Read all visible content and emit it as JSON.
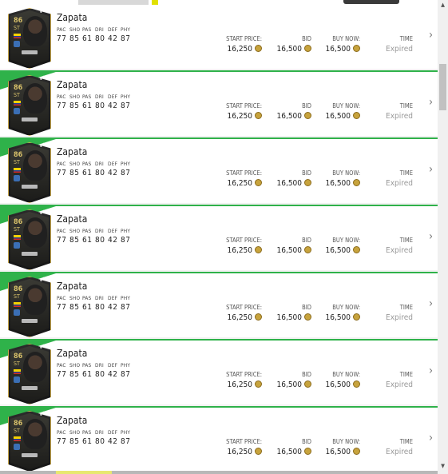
{
  "stat_labels": [
    "PAC",
    "SHO",
    "PAS",
    "DRI",
    "DEF",
    "PHY"
  ],
  "column_labels": {
    "start": "START PRICE:",
    "bid": "BID",
    "buy_now": "BUY NOW:",
    "time": "TIME"
  },
  "items": [
    {
      "name": "Zapata",
      "rating": "86",
      "position": "ST",
      "stats": [
        "77",
        "85",
        "61",
        "80",
        "42",
        "87"
      ],
      "start_price": "16,250",
      "bid": "16,500",
      "buy_now": "16,500",
      "time": "Expired"
    },
    {
      "name": "Zapata",
      "rating": "86",
      "position": "ST",
      "stats": [
        "77",
        "85",
        "61",
        "80",
        "42",
        "87"
      ],
      "start_price": "16,250",
      "bid": "16,500",
      "buy_now": "16,500",
      "time": "Expired"
    },
    {
      "name": "Zapata",
      "rating": "86",
      "position": "ST",
      "stats": [
        "77",
        "85",
        "61",
        "80",
        "42",
        "87"
      ],
      "start_price": "16,250",
      "bid": "16,500",
      "buy_now": "16,500",
      "time": "Expired"
    },
    {
      "name": "Zapata",
      "rating": "86",
      "position": "ST",
      "stats": [
        "77",
        "85",
        "61",
        "80",
        "42",
        "87"
      ],
      "start_price": "16,250",
      "bid": "16,500",
      "buy_now": "16,500",
      "time": "Expired"
    },
    {
      "name": "Zapata",
      "rating": "86",
      "position": "ST",
      "stats": [
        "77",
        "85",
        "61",
        "80",
        "42",
        "87"
      ],
      "start_price": "16,250",
      "bid": "16,500",
      "buy_now": "16,500",
      "time": "Expired"
    },
    {
      "name": "Zapata",
      "rating": "86",
      "position": "ST",
      "stats": [
        "77",
        "85",
        "61",
        "80",
        "42",
        "87"
      ],
      "start_price": "16,250",
      "bid": "16,500",
      "buy_now": "16,500",
      "time": "Expired"
    },
    {
      "name": "Zapata",
      "rating": "86",
      "position": "ST",
      "stats": [
        "77",
        "85",
        "61",
        "80",
        "42",
        "87"
      ],
      "start_price": "16,250",
      "bid": "16,500",
      "buy_now": "16,500",
      "time": "Expired"
    }
  ],
  "icons": {
    "coin": "coin-icon",
    "chevron": "chevron-right-icon",
    "check": "check-icon"
  },
  "colors": {
    "accent_green": "#2fb24a",
    "card_gold": "#c8a74a",
    "coin_gold": "#c7a33d"
  }
}
